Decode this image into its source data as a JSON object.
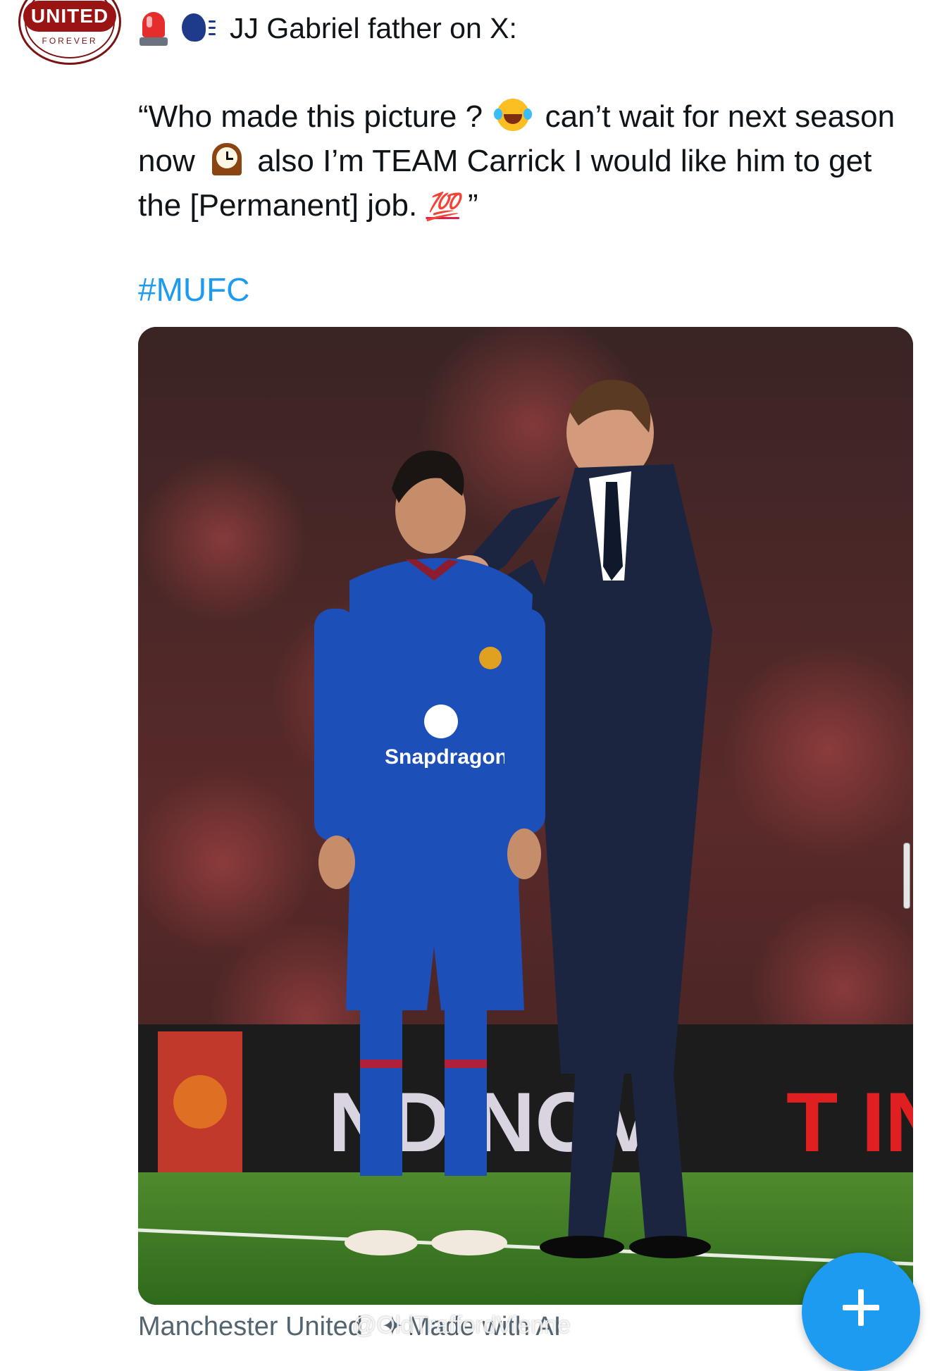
{
  "account": {
    "avatar_text": "UNITED",
    "avatar_subtext": "FOREVER"
  },
  "post": {
    "title": "JJ Gabriel father on X:",
    "quote_part1": "“Who made this picture ?",
    "quote_part2": "can’t wait for next season now",
    "quote_part3": "also I’m TEAM Carrick I would like him to get the [Permanent] job.",
    "quote_hundred": "💯",
    "quote_end": "”",
    "hashtag": "#MUFC",
    "caption_left": "Manchester United",
    "caption_right": "Made with AI",
    "watermark": "@OldTraffordVienne"
  },
  "media": {
    "shirt_sponsor": "Snapdragon",
    "board_text_left": "ND NOV",
    "board_text_right": "T IN"
  },
  "icons": {
    "header_1": "rotating-light-icon",
    "header_2": "speaking-head-icon",
    "inline_1": "tears-of-joy-icon",
    "inline_2": "mantelpiece-clock-icon",
    "inline_3": "hundred-points-icon",
    "fab": "plus-icon"
  },
  "colors": {
    "link": "#1d9bf0",
    "fab": "#1d9bf0",
    "text": "#0f1419",
    "muted": "#536471"
  }
}
